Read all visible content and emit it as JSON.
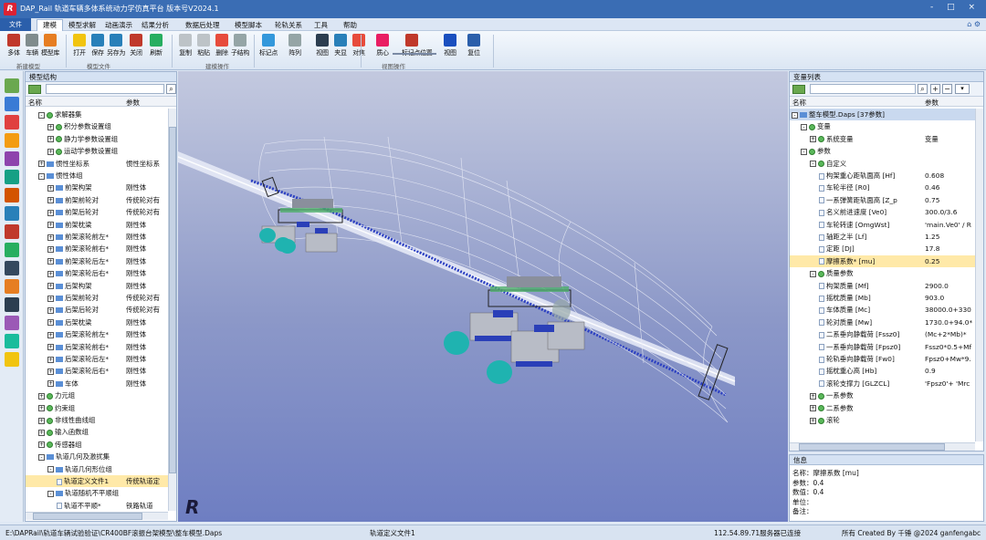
{
  "window": {
    "title": "DAP_Rail 轨道车辆多体系统动力学仿真平台 版本号V2024.1",
    "controls": "- □ ×"
  },
  "menus": [
    {
      "label": "建模",
      "active": true
    },
    {
      "label": "模型求解"
    },
    {
      "label": "动画演示"
    },
    {
      "label": "结果分析"
    },
    {
      "label": "数据后处理"
    },
    {
      "label": "模型脚本"
    },
    {
      "label": "轮轨关系"
    },
    {
      "label": "工具"
    },
    {
      "label": "帮助"
    }
  ],
  "app_button": "文件",
  "ribbon": {
    "buttons": [
      "多体",
      "车辆",
      "模型库",
      "打开",
      "保存",
      "另存为",
      "关闭",
      "刷新",
      "复制",
      "粘贴",
      "删除",
      "子结构",
      "标记点",
      "阵列",
      "视图",
      "夹显",
      "对焦",
      "质心",
      "标记点位置",
      "视图",
      "复位"
    ],
    "groups": [
      "新建模型",
      "模型文件",
      "建模操作",
      "视图操作"
    ]
  },
  "left_panel": {
    "title": "模型结构",
    "col_name": "名称",
    "col_param": "参数",
    "rows": [
      {
        "n": "求解器集",
        "v": "",
        "lvl": 1,
        "pm": "-",
        "ic": "g"
      },
      {
        "n": "积分参数设置组",
        "v": "",
        "lvl": 2,
        "pm": "+",
        "ic": "g"
      },
      {
        "n": "静力学参数设置组",
        "v": "",
        "lvl": 2,
        "pm": "+",
        "ic": "g"
      },
      {
        "n": "运动学参数设置组",
        "v": "",
        "lvl": 2,
        "pm": "+",
        "ic": "g"
      },
      {
        "n": "惯性坐标系",
        "v": "惯性坐标系",
        "lvl": 1,
        "pm": "+",
        "ic": "b"
      },
      {
        "n": "惯性体组",
        "v": "",
        "lvl": 1,
        "pm": "-",
        "ic": "b"
      },
      {
        "n": "前架构架",
        "v": "刚性体",
        "lvl": 2,
        "pm": "+",
        "ic": "b"
      },
      {
        "n": "前架前轮对",
        "v": "传统轮对有",
        "lvl": 2,
        "pm": "+",
        "ic": "b"
      },
      {
        "n": "前架后轮对",
        "v": "传统轮对有",
        "lvl": 2,
        "pm": "+",
        "ic": "b"
      },
      {
        "n": "前架枕梁",
        "v": "刚性体",
        "lvl": 2,
        "pm": "+",
        "ic": "b"
      },
      {
        "n": "前架滚轮前左*",
        "v": "刚性体",
        "lvl": 2,
        "pm": "+",
        "ic": "b"
      },
      {
        "n": "前架滚轮前右*",
        "v": "刚性体",
        "lvl": 2,
        "pm": "+",
        "ic": "b"
      },
      {
        "n": "前架滚轮后左*",
        "v": "刚性体",
        "lvl": 2,
        "pm": "+",
        "ic": "b"
      },
      {
        "n": "前架滚轮后右*",
        "v": "刚性体",
        "lvl": 2,
        "pm": "+",
        "ic": "b"
      },
      {
        "n": "后架构架",
        "v": "刚性体",
        "lvl": 2,
        "pm": "+",
        "ic": "b"
      },
      {
        "n": "后架前轮对",
        "v": "传统轮对有",
        "lvl": 2,
        "pm": "+",
        "ic": "b"
      },
      {
        "n": "后架后轮对",
        "v": "传统轮对有",
        "lvl": 2,
        "pm": "+",
        "ic": "b"
      },
      {
        "n": "后架枕梁",
        "v": "刚性体",
        "lvl": 2,
        "pm": "+",
        "ic": "b"
      },
      {
        "n": "后架滚轮前左*",
        "v": "刚性体",
        "lvl": 2,
        "pm": "+",
        "ic": "b"
      },
      {
        "n": "后架滚轮前右*",
        "v": "刚性体",
        "lvl": 2,
        "pm": "+",
        "ic": "b"
      },
      {
        "n": "后架滚轮后左*",
        "v": "刚性体",
        "lvl": 2,
        "pm": "+",
        "ic": "b"
      },
      {
        "n": "后架滚轮后右*",
        "v": "刚性体",
        "lvl": 2,
        "pm": "+",
        "ic": "b"
      },
      {
        "n": "车体",
        "v": "刚性体",
        "lvl": 2,
        "pm": "+",
        "ic": "b"
      },
      {
        "n": "力元组",
        "v": "",
        "lvl": 1,
        "pm": "+",
        "ic": "g"
      },
      {
        "n": "约束组",
        "v": "",
        "lvl": 1,
        "pm": "+",
        "ic": "g"
      },
      {
        "n": "非线性曲线组",
        "v": "",
        "lvl": 1,
        "pm": "+",
        "ic": "g"
      },
      {
        "n": "输入函数组",
        "v": "",
        "lvl": 1,
        "pm": "+",
        "ic": "g"
      },
      {
        "n": "传感器组",
        "v": "",
        "lvl": 1,
        "pm": "+",
        "ic": "g"
      },
      {
        "n": "轨道几何及激扰集",
        "v": "",
        "lvl": 1,
        "pm": "-",
        "ic": "b"
      },
      {
        "n": "轨道几何形位组",
        "v": "",
        "lvl": 2,
        "pm": "-",
        "ic": "b"
      },
      {
        "n": "轨道定义文件1",
        "v": "传统轨道定",
        "lvl": 3,
        "pm": "",
        "ic": "d",
        "hl": true
      },
      {
        "n": "轨道随机不平顺组",
        "v": "",
        "lvl": 2,
        "pm": "-",
        "ic": "b"
      },
      {
        "n": "轨道不平顺*",
        "v": "铁路轨道",
        "lvl": 3,
        "pm": "",
        "ic": "d"
      }
    ]
  },
  "right_panel": {
    "title": "变量列表",
    "col_name": "名称",
    "col_param": "参数",
    "rows": [
      {
        "n": "整车模型.Daps  [37参数]",
        "v": "",
        "lvl": 0,
        "pm": "-",
        "ic": "b",
        "sel": true
      },
      {
        "n": "变量",
        "v": "",
        "lvl": 1,
        "pm": "-",
        "ic": "g"
      },
      {
        "n": "系统变量",
        "v": "变量",
        "lvl": 2,
        "pm": "+",
        "ic": "g"
      },
      {
        "n": "参数",
        "v": "",
        "lvl": 1,
        "pm": "-",
        "ic": "g"
      },
      {
        "n": "自定义",
        "v": "",
        "lvl": 2,
        "pm": "-",
        "ic": "g"
      },
      {
        "n": "构架重心距轨面高 [Hf]",
        "v": "0.608",
        "lvl": 3,
        "pm": "",
        "ic": "d"
      },
      {
        "n": "车轮半径 [R0]",
        "v": "0.46",
        "lvl": 3,
        "pm": "",
        "ic": "d"
      },
      {
        "n": "一系弹簧距轨面高 [Z_p",
        "v": "0.75",
        "lvl": 3,
        "pm": "",
        "ic": "d"
      },
      {
        "n": "名义前进速度 [Ve0]",
        "v": "300.0/3.6",
        "lvl": 3,
        "pm": "",
        "ic": "d"
      },
      {
        "n": "车轮转速 [OmgWst]",
        "v": "'main.Ve0' / R",
        "lvl": 3,
        "pm": "",
        "ic": "d"
      },
      {
        "n": "轴距之半 [Lf]",
        "v": "1.25",
        "lvl": 3,
        "pm": "",
        "ic": "d"
      },
      {
        "n": "定距 [DJ]",
        "v": "17.8",
        "lvl": 3,
        "pm": "",
        "ic": "d"
      },
      {
        "n": "摩擦系数* [mu]",
        "v": "0.25",
        "lvl": 3,
        "pm": "",
        "ic": "d",
        "hl": true
      },
      {
        "n": "质量参数",
        "v": "",
        "lvl": 2,
        "pm": "-",
        "ic": "g"
      },
      {
        "n": "构架质量 [Mf]",
        "v": "2900.0",
        "lvl": 3,
        "pm": "",
        "ic": "d"
      },
      {
        "n": "摇枕质量 [Mb]",
        "v": "903.0",
        "lvl": 3,
        "pm": "",
        "ic": "d"
      },
      {
        "n": "车体质量 [Mc]",
        "v": "38000.0+330",
        "lvl": 3,
        "pm": "",
        "ic": "d"
      },
      {
        "n": "轮对质量 [Mw]",
        "v": "1730.0+94.0*",
        "lvl": 3,
        "pm": "",
        "ic": "d"
      },
      {
        "n": "二系垂向静载荷 [Fssz0]",
        "v": "(Mc+2*Mb)*",
        "lvl": 3,
        "pm": "",
        "ic": "d"
      },
      {
        "n": "一系垂向静载荷 [Fpsz0]",
        "v": "Fssz0*0.5+Mf",
        "lvl": 3,
        "pm": "",
        "ic": "d"
      },
      {
        "n": "轮轨垂向静载荷 [Fw0]",
        "v": "Fpsz0+Mw*9.",
        "lvl": 3,
        "pm": "",
        "ic": "d"
      },
      {
        "n": "摇枕重心高 [Hb]",
        "v": "0.9",
        "lvl": 3,
        "pm": "",
        "ic": "d"
      },
      {
        "n": "滚轮支撑力 [GLZCL]",
        "v": "'Fpsz0'+ 'Mrc",
        "lvl": 3,
        "pm": "",
        "ic": "d"
      },
      {
        "n": "一系参数",
        "v": "",
        "lvl": 2,
        "pm": "+",
        "ic": "g"
      },
      {
        "n": "二系参数",
        "v": "",
        "lvl": 2,
        "pm": "+",
        "ic": "g"
      },
      {
        "n": "滚轮",
        "v": "",
        "lvl": 2,
        "pm": "+",
        "ic": "g"
      }
    ]
  },
  "info_panel": {
    "title": "信息",
    "lines": [
      "名称：摩擦系数 [mu]",
      "参数：0.4",
      "数值：0.4",
      "单位：",
      "备注："
    ]
  },
  "status": {
    "path": "E:\\DAPRail\\轨道车辆试验验证\\CR400BF滚振台架模型\\整车模型.Daps",
    "item": "轨道定义文件1",
    "server": "112.54.89.71服务器已连接",
    "copyright": "所有 Created By 千锤 @2024 ganfengabc"
  },
  "colors": {
    "title": "#3a6db4",
    "viewport_top": "#c3c9df",
    "viewport_bottom": "#6e7ec2",
    "highlight": "#ffe9a8",
    "accent": "#2b5fab"
  }
}
